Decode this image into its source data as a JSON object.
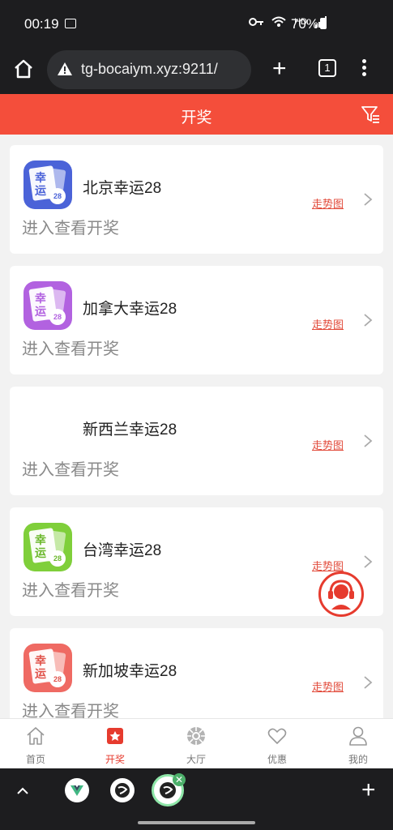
{
  "status_bar": {
    "time": "00:19",
    "hd": "HD",
    "battery": "70%"
  },
  "browser": {
    "url": "tg-bocaiym.xyz:9211/",
    "tab_count": "1"
  },
  "header": {
    "title": "开奖"
  },
  "cards": [
    {
      "name": "北京幸运28",
      "subtitle": "进入查看开奖",
      "trend_label": "走势图",
      "icon_color": "#4b63d8",
      "icon_text_1": "幸",
      "icon_text_2": "运",
      "ball": "28",
      "has_icon": true
    },
    {
      "name": "加拿大幸运28",
      "subtitle": "进入查看开奖",
      "trend_label": "走势图",
      "icon_color": "#b262e0",
      "icon_text_1": "幸",
      "icon_text_2": "运",
      "ball": "28",
      "has_icon": true
    },
    {
      "name": "新西兰幸运28",
      "subtitle": "进入查看开奖",
      "trend_label": "走势图",
      "has_icon": false
    },
    {
      "name": "台湾幸运28",
      "subtitle": "进入查看开奖",
      "trend_label": "走势图",
      "icon_color": "#7fcf3a",
      "icon_text_1": "幸",
      "icon_text_2": "运",
      "ball": "28",
      "has_icon": true
    },
    {
      "name": "新加坡幸运28",
      "subtitle": "进入查看开奖",
      "trend_label": "走势图",
      "icon_color": "#ef6a63",
      "icon_text_1": "幸",
      "icon_text_2": "运",
      "ball": "28",
      "has_icon": true
    }
  ],
  "tabs": [
    {
      "label": "首页",
      "icon": "home-icon",
      "active": false
    },
    {
      "label": "开奖",
      "icon": "lottery-icon",
      "active": true
    },
    {
      "label": "大厅",
      "icon": "lobby-icon",
      "active": false
    },
    {
      "label": "优惠",
      "icon": "heart-icon",
      "active": false
    },
    {
      "label": "我的",
      "icon": "user-icon",
      "active": false
    }
  ],
  "colors": {
    "accent": "#f44e3b",
    "active_tab": "#e63b2e"
  }
}
